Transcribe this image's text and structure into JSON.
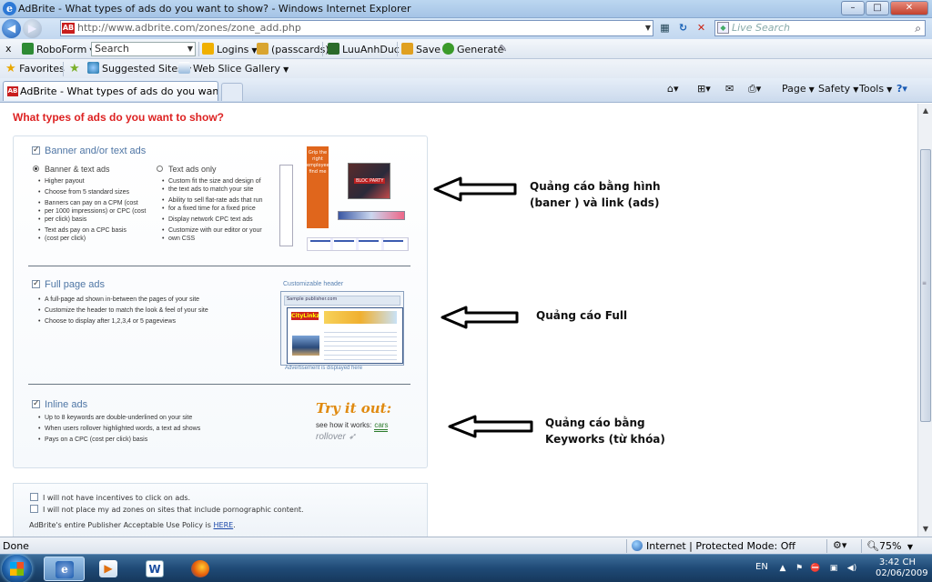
{
  "window": {
    "title": "AdBrite - What types of ads do you want to show? - Windows Internet Explorer",
    "minimize": "–",
    "maximize": "□",
    "close": "✕"
  },
  "address_bar": {
    "favicon": "AB",
    "url": "http://www.adbrite.com/zones/zone_add.php",
    "search_placeholder": "Live Search"
  },
  "roboform_bar": {
    "close": "x",
    "roboform_label": "RoboForm",
    "search_value": "Search",
    "logins_label": "Logins",
    "passcards_label": "(passcards)",
    "user_label": "LuuAnhDuc",
    "save_label": "Save",
    "generate_label": "Generate"
  },
  "favorites_bar": {
    "favorites_label": "Favorites",
    "suggested_sites_label": "Suggested Sites",
    "web_slice_label": "Web Slice Gallery"
  },
  "tab_row": {
    "active_tab_title": "AdBrite - What types of ads do you want to show?",
    "page_label": "Page",
    "safety_label": "Safety",
    "tools_label": "Tools"
  },
  "page": {
    "heading": "What types of ads do you want to show?",
    "banner_section": {
      "title": "Banner and/or text ads",
      "option1_title": "Banner & text ads",
      "option1_bullets": [
        "Higher payout",
        "Choose from 5 standard sizes",
        "Banners can pay on a CPM (cost",
        "per 1000 impressions) or CPC (cost",
        "per click) basis",
        "Text ads pay on a CPC basis",
        "(cost per click)"
      ],
      "option2_title": "Text ads only",
      "option2_bullets": [
        "Custom fit the size and design of",
        "the text ads to match your site",
        "Ability to sell flat-rate ads that run",
        "for a fixed time for a fixed price",
        "Display network CPC text ads",
        "Customize with our editor or your",
        "own CSS"
      ],
      "illus_skyscraper_text": "Grip the right employees find me",
      "illus_photo_text": "BLOC PARTY"
    },
    "fullpage_section": {
      "title": "Full page ads",
      "bullets": [
        "A full-page ad shown in-between the pages of your site",
        "Customize the header to match the look & feel of your site",
        "Choose to display after 1,2,3,4 or 5 pageviews"
      ],
      "illus_top_label": "Customizable header",
      "illus_header_text": "Sample publisher.com",
      "illus_logo": "CityLinkz",
      "illus_bottom_label": "Advertisement is displayed here"
    },
    "inline_section": {
      "title": "Inline ads",
      "bullets": [
        "Up to 8 keywords are double-underlined on your site",
        "When users rollover highlighted words, a text ad shows",
        "Pays on a CPC (cost per click) basis"
      ],
      "try_it_out": "Try it out:",
      "see_how": "see how it works:",
      "cars": "cars",
      "rollover": "rollover"
    },
    "agreements": {
      "line1": "I will not have incentives to click on ads.",
      "line2": "I will not place my ad zones on sites that include pornographic content.",
      "policy_prefix": "AdBrite's entire Publisher Acceptable Use Policy is ",
      "policy_link": "HERE",
      "policy_suffix": "."
    },
    "annotations": {
      "banner_line1": "Quảng cáo bằng hình",
      "banner_line2": "(baner ) và link (ads)",
      "full": "Quảng cáo Full",
      "inline_line1": "Quảng cáo bằng",
      "inline_line2": "Keyworks (từ khóa)"
    }
  },
  "status_bar": {
    "text": "Done",
    "zone": "Internet | Protected Mode: Off",
    "zoom": "75%"
  },
  "taskbar": {
    "language": "EN",
    "time": "3:42 CH",
    "date": "02/06/2009"
  }
}
